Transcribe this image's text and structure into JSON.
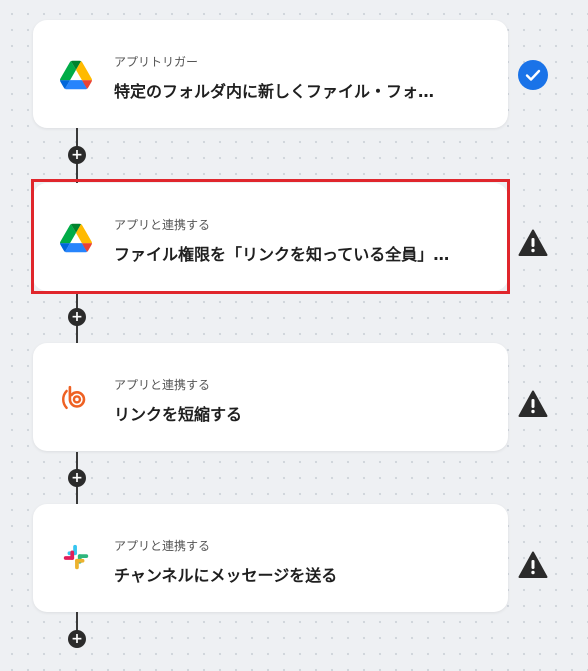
{
  "steps": [
    {
      "subtitle": "アプリトリガー",
      "title": "特定のフォルダ内に新しくファイル・フォ…",
      "icon": "google-drive-icon",
      "status": "complete-check-icon"
    },
    {
      "subtitle": "アプリと連携する",
      "title": "ファイル権限を「リンクを知っている全員」…",
      "icon": "google-drive-icon",
      "status": "warning-icon",
      "selected": true
    },
    {
      "subtitle": "アプリと連携する",
      "title": "リンクを短縮する",
      "icon": "bitly-icon",
      "status": "warning-icon"
    },
    {
      "subtitle": "アプリと連携する",
      "title": "チャンネルにメッセージを送る",
      "icon": "slack-icon",
      "status": "warning-icon"
    }
  ],
  "add_step_label": "+",
  "colors": {
    "check_blue": "#1a73e8",
    "warning_dark": "#2b2b2b",
    "selection_red": "#e0262c",
    "bitly_orange": "#ee6123"
  }
}
